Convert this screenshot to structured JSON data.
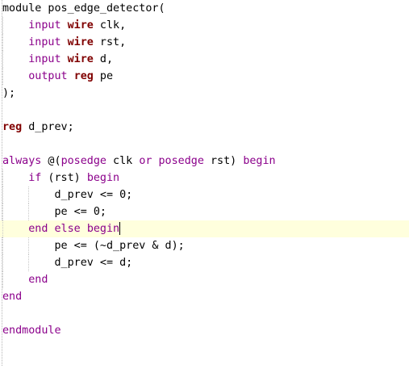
{
  "editor": {
    "colors": {
      "keyword": "#8b008b",
      "type": "#800000",
      "text": "#000000",
      "current_line": "#ffffdd"
    },
    "lines": [
      [
        {
          "t": "module",
          "c": "tok"
        },
        {
          "t": " pos_edge_detector(",
          "c": "tok"
        }
      ],
      [
        {
          "t": "    ",
          "c": "tok"
        },
        {
          "t": "input",
          "c": "kw"
        },
        {
          "t": " ",
          "c": "tok"
        },
        {
          "t": "wire",
          "c": "ty"
        },
        {
          "t": " clk,",
          "c": "tok"
        }
      ],
      [
        {
          "t": "    ",
          "c": "tok"
        },
        {
          "t": "input",
          "c": "kw"
        },
        {
          "t": " ",
          "c": "tok"
        },
        {
          "t": "wire",
          "c": "ty"
        },
        {
          "t": " rst,",
          "c": "tok"
        }
      ],
      [
        {
          "t": "    ",
          "c": "tok"
        },
        {
          "t": "input",
          "c": "kw"
        },
        {
          "t": " ",
          "c": "tok"
        },
        {
          "t": "wire",
          "c": "ty"
        },
        {
          "t": " d,",
          "c": "tok"
        }
      ],
      [
        {
          "t": "    ",
          "c": "tok"
        },
        {
          "t": "output",
          "c": "kw"
        },
        {
          "t": " ",
          "c": "tok"
        },
        {
          "t": "reg",
          "c": "ty"
        },
        {
          "t": " pe",
          "c": "tok"
        }
      ],
      [
        {
          "t": ");",
          "c": "tok"
        }
      ],
      [],
      [
        {
          "t": "reg",
          "c": "ty"
        },
        {
          "t": " d_prev;",
          "c": "tok"
        }
      ],
      [],
      [
        {
          "t": "always",
          "c": "kw"
        },
        {
          "t": " @(",
          "c": "tok"
        },
        {
          "t": "posedge",
          "c": "kw"
        },
        {
          "t": " clk ",
          "c": "tok"
        },
        {
          "t": "or",
          "c": "kw"
        },
        {
          "t": " ",
          "c": "tok"
        },
        {
          "t": "posedge",
          "c": "kw"
        },
        {
          "t": " rst) ",
          "c": "tok"
        },
        {
          "t": "begin",
          "c": "kw"
        }
      ],
      [
        {
          "t": "    ",
          "c": "tok"
        },
        {
          "t": "if",
          "c": "kw"
        },
        {
          "t": " (rst) ",
          "c": "tok"
        },
        {
          "t": "begin",
          "c": "kw"
        }
      ],
      [
        {
          "t": "        d_prev <= 0;",
          "c": "tok"
        }
      ],
      [
        {
          "t": "        pe <= 0;",
          "c": "tok"
        }
      ],
      [
        {
          "t": "    ",
          "c": "tok"
        },
        {
          "t": "end",
          "c": "kw"
        },
        {
          "t": " ",
          "c": "tok"
        },
        {
          "t": "else",
          "c": "kw"
        },
        {
          "t": " ",
          "c": "tok"
        },
        {
          "t": "begin",
          "c": "kw"
        }
      ],
      [
        {
          "t": "        pe <= (~d_prev & d);",
          "c": "tok"
        }
      ],
      [
        {
          "t": "        d_prev <= d;",
          "c": "tok"
        }
      ],
      [
        {
          "t": "    ",
          "c": "tok"
        },
        {
          "t": "end",
          "c": "kw"
        }
      ],
      [
        {
          "t": "end",
          "c": "kw"
        }
      ],
      [],
      [
        {
          "t": "endmodule",
          "c": "kw"
        }
      ],
      [],
      []
    ],
    "current_line_index": 13
  }
}
